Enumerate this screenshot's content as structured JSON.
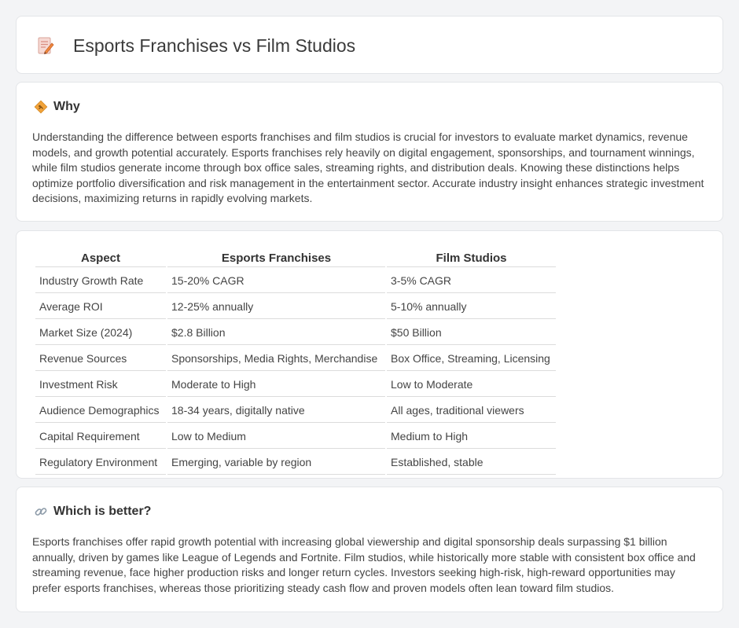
{
  "header": {
    "title": "Esports Franchises vs Film Studios",
    "icon": "memo-pencil-icon"
  },
  "why": {
    "icon": "diamond-sign-icon",
    "heading": "Why",
    "text": "Understanding the difference between esports franchises and film studios is crucial for investors to evaluate market dynamics, revenue models, and growth potential accurately. Esports franchises rely heavily on digital engagement, sponsorships, and tournament winnings, while film studios generate income through box office sales, streaming rights, and distribution deals. Knowing these distinctions helps optimize portfolio diversification and risk management in the entertainment sector. Accurate industry insight enhances strategic investment decisions, maximizing returns in rapidly evolving markets."
  },
  "table": {
    "headers": [
      "Aspect",
      "Esports Franchises",
      "Film Studios"
    ],
    "rows": [
      [
        "Industry Growth Rate",
        "15-20% CAGR",
        "3-5% CAGR"
      ],
      [
        "Average ROI",
        "12-25% annually",
        "5-10% annually"
      ],
      [
        "Market Size (2024)",
        "$2.8 Billion",
        "$50 Billion"
      ],
      [
        "Revenue Sources",
        "Sponsorships, Media Rights, Merchandise",
        "Box Office, Streaming, Licensing"
      ],
      [
        "Investment Risk",
        "Moderate to High",
        "Low to Moderate"
      ],
      [
        "Audience Demographics",
        "18-34 years, digitally native",
        "All ages, traditional viewers"
      ],
      [
        "Capital Requirement",
        "Low to Medium",
        "Medium to High"
      ],
      [
        "Regulatory Environment",
        "Emerging, variable by region",
        "Established, stable"
      ]
    ]
  },
  "better": {
    "icon": "link-icon",
    "heading": "Which is better?",
    "text": "Esports franchises offer rapid growth potential with increasing global viewership and digital sponsorship deals surpassing $1 billion annually, driven by games like League of Legends and Fortnite. Film studios, while historically more stable with consistent box office and streaming revenue, face higher production risks and longer return cycles. Investors seeking high-risk, high-reward opportunities may prefer esports franchises, whereas those prioritizing steady cash flow and proven models often lean toward film studios."
  },
  "colors": {
    "background": "#f3f4f6",
    "card": "#ffffff",
    "accent_orange": "#f0a030",
    "icon_pink": "#e8767a"
  }
}
